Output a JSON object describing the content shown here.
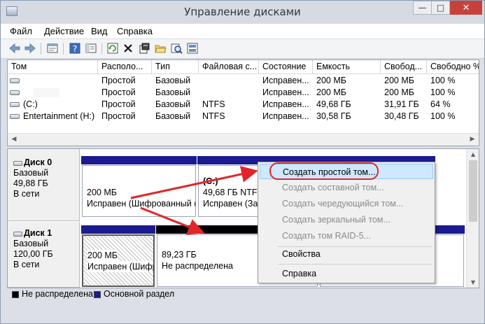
{
  "window": {
    "title": "Управление дисками",
    "controls": {
      "minimize": "—",
      "maximize": "□",
      "close": "✕"
    }
  },
  "menu": [
    "Файл",
    "Действие",
    "Вид",
    "Справка"
  ],
  "toolbar_icons": [
    "back-arrow-icon",
    "forward-arrow-icon",
    "properties-icon",
    "help-icon",
    "show-hide-icon",
    "refresh-icon",
    "delete-icon",
    "properties-sheet-icon",
    "open-folder-icon",
    "explore-icon",
    "rescan-icon"
  ],
  "volume_table": {
    "columns": [
      "Том",
      "Располо...",
      "Тип",
      "Файловая с...",
      "Состояние",
      "Емкость",
      "Свобод...",
      "Свободно %"
    ],
    "rows": [
      [
        "",
        "Простой",
        "Базовый",
        "",
        "Исправен...",
        "200 МБ",
        "200 МБ",
        "100 %"
      ],
      [
        "",
        "Простой",
        "Базовый",
        "",
        "Исправен...",
        "200 МБ",
        "200 МБ",
        "100 %"
      ],
      [
        "(C:)",
        "Простой",
        "Базовый",
        "NTFS",
        "Исправен...",
        "49,68 ГБ",
        "31,91 ГБ",
        "64 %"
      ],
      [
        "Entertainment (H:)",
        "Простой",
        "Базовый",
        "NTFS",
        "Исправен...",
        "30,58 ГБ",
        "30,48 ГБ",
        "100 %"
      ]
    ]
  },
  "disks": [
    {
      "name": "Диск 0",
      "type": "Базовый",
      "size": "49,88 ГБ",
      "status": "В сети",
      "partitions": [
        {
          "line1": "200 МБ",
          "line2": "Исправен (Шифрованный ("
        },
        {
          "title": "(C:)",
          "line1": "49,68 ГБ NTFS",
          "line2": "Исправен (Заг"
        }
      ]
    },
    {
      "name": "Диск 1",
      "type": "Базовый",
      "size": "120,00 ГБ",
      "status": "В сети",
      "partitions": [
        {
          "line1": "200 МБ",
          "line2": "Исправен (Шифр"
        },
        {
          "line1": "89,23 ГБ",
          "line2": "Не распределена"
        }
      ]
    }
  ],
  "legend": [
    {
      "label": "Не распределена",
      "color": "#000000"
    },
    {
      "label": "Основной раздел",
      "color": "#1b1b8f"
    }
  ],
  "context_menu": {
    "items": [
      {
        "label": "Создать простой том...",
        "enabled": true,
        "highlighted": true
      },
      {
        "label": "Создать составной том...",
        "enabled": false
      },
      {
        "label": "Создать чередующийся том...",
        "enabled": false
      },
      {
        "label": "Создать зеркальный том...",
        "enabled": false
      },
      {
        "label": "Создать том RAID-5...",
        "enabled": false
      },
      {
        "label": "Свойства",
        "enabled": true
      },
      {
        "label": "Справка",
        "enabled": true
      }
    ]
  },
  "colors": {
    "primary_partition": "#1b1b8f",
    "unallocated": "#000000",
    "highlight_ellipse": "#e0262a",
    "arrow": "#e0262a"
  }
}
